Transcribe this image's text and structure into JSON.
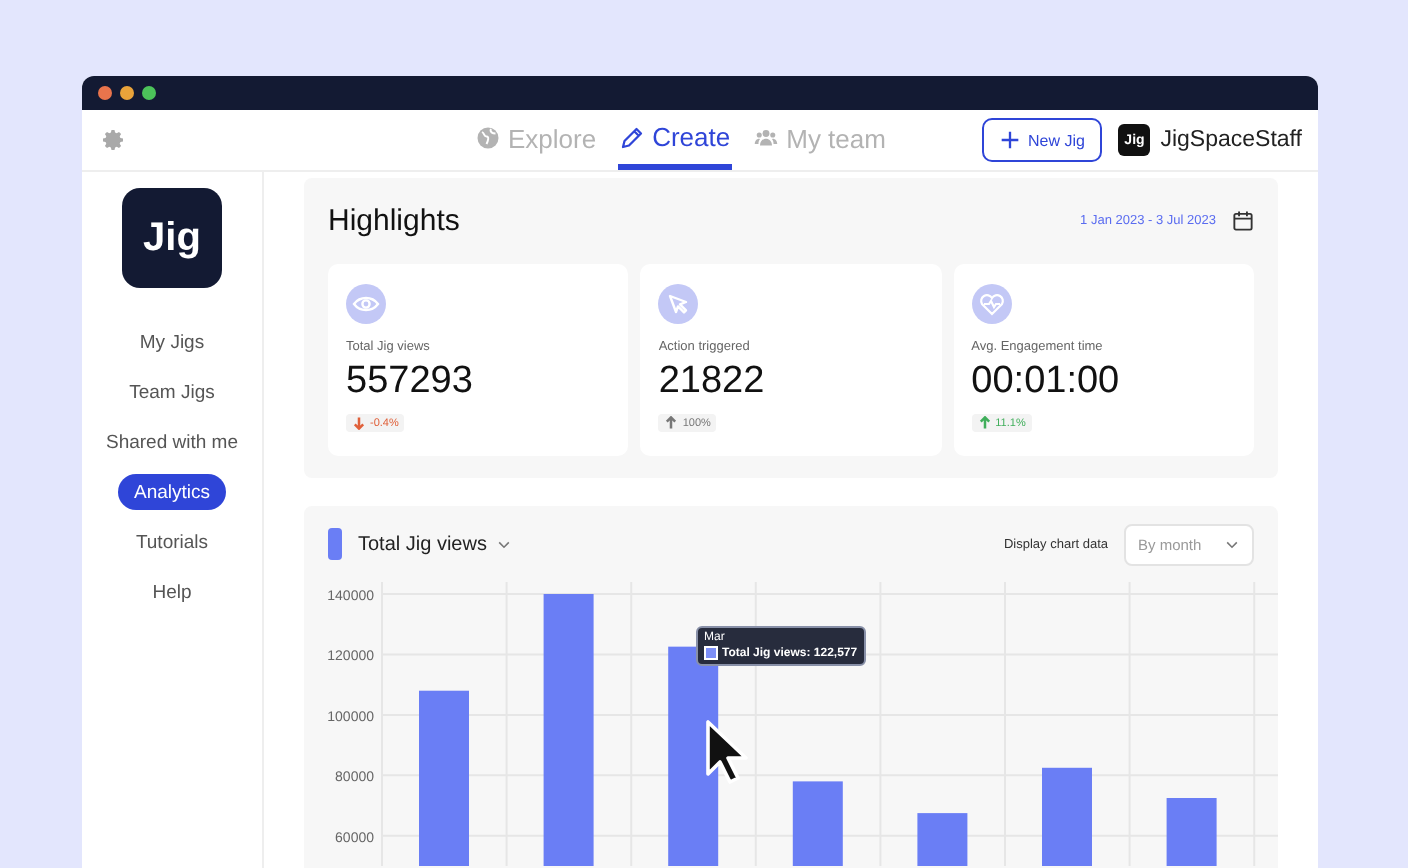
{
  "nav": {
    "tabs": [
      {
        "label": "Explore",
        "selected": false
      },
      {
        "label": "Create",
        "selected": true
      },
      {
        "label": "My team",
        "selected": false
      }
    ],
    "new_button": "New Jig",
    "account": "JigSpaceStaff",
    "account_logo": "Jig"
  },
  "sidebar": {
    "logo": "Jig",
    "items": [
      {
        "label": "My Jigs",
        "selected": false
      },
      {
        "label": "Team Jigs",
        "selected": false
      },
      {
        "label": "Shared with me",
        "selected": false
      },
      {
        "label": "Analytics",
        "selected": true
      },
      {
        "label": "Tutorials",
        "selected": false
      },
      {
        "label": "Help",
        "selected": false
      }
    ]
  },
  "highlights": {
    "title": "Highlights",
    "date_range": "1 Jan 2023 - 3 Jul 2023",
    "cards": [
      {
        "label": "Total Jig views",
        "value": "557293",
        "delta": {
          "text": "-0.4%",
          "kind": "down",
          "color": "#e0603a"
        }
      },
      {
        "label": "Action triggered",
        "value": "21822",
        "delta": {
          "text": "100%",
          "kind": "up",
          "color": "#777777"
        }
      },
      {
        "label": "Avg. Engagement time",
        "value": "00:01:00",
        "delta": {
          "text": "11.1%",
          "kind": "up",
          "color": "#3fae5a"
        }
      }
    ]
  },
  "chart": {
    "display_label": "Display chart data",
    "period": "By month",
    "chart_data": {
      "type": "bar",
      "grid": true,
      "series": [
        {
          "name": "Total Jig views",
          "color": "#6a7ef5",
          "values": [
            108000,
            140000,
            122577,
            78000,
            67500,
            82500,
            72500
          ]
        }
      ],
      "ylim": [
        50000,
        140000
      ],
      "yticks": [
        60000,
        80000,
        100000,
        120000,
        140000
      ]
    },
    "tooltip": {
      "title": "Mar",
      "text": "Total Jig views: 122,577"
    }
  }
}
